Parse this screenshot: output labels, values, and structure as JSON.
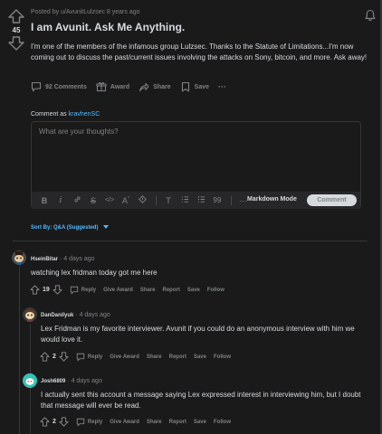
{
  "post": {
    "score": "45",
    "meta": "Posted by u/AvunitLulzsec 8 years ago",
    "title": "I am Avunit. Ask Me Anything.",
    "body": "I'm one of the members of the infamous group Lulzsec. Thanks to the Statute of Limitations...I'm now coming out to discuss the past/current issues involving the attacks on Sony, bitcoin, and more. Ask away!",
    "actions": {
      "comments": "92 Comments",
      "award": "Award",
      "share": "Share",
      "save": "Save",
      "more": "···"
    }
  },
  "composer": {
    "comment_as_prefix": "Comment as",
    "username": "kravhenSC",
    "placeholder": "What are your thoughts?",
    "toolbar": {
      "bold": "B",
      "italic": "i",
      "markdown_mode": "Markdown Mode",
      "comment_button": "Comment",
      "more": "···",
      "heading": "T",
      "quote": "99"
    }
  },
  "sort": {
    "label": "Sort By: Q&A (Suggested)"
  },
  "comments": [
    {
      "author": "HseinBitar",
      "time": "· 4 days ago",
      "text": "watching lex fridman today got me here",
      "votes": "19",
      "actions": [
        "Reply",
        "Give Award",
        "Share",
        "Report",
        "Save",
        "Follow"
      ]
    },
    {
      "author": "DanDanilyuk",
      "time": "· 4 days ago",
      "text": "Lex Fridman is my favorite interviewer. Avunit if you could do an anonymous interview with him we would love it.",
      "votes": "2",
      "actions": [
        "Reply",
        "Give Award",
        "Share",
        "Report",
        "Save",
        "Follow"
      ]
    },
    {
      "author": "Josh6809",
      "time": "· 4 days ago",
      "text": "I actually sent this account a message saying Lex expressed interest in interviewing him, but I doubt that message will ever be read.",
      "votes": "2",
      "actions": [
        "Reply",
        "Give Award",
        "Share",
        "Report",
        "Save",
        "Follow"
      ]
    }
  ],
  "colors": {
    "background": "#1a1a1b",
    "text": "#d7dadc",
    "muted": "#818384",
    "link": "#4fbcff",
    "border": "#343536"
  }
}
